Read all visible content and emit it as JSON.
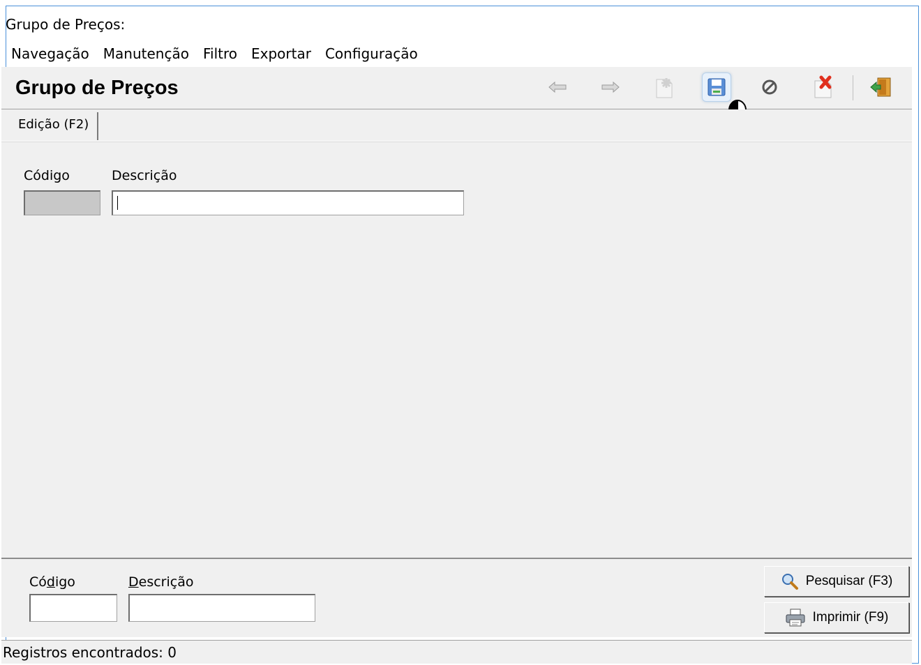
{
  "window": {
    "title": "Grupo de Preços:"
  },
  "menu": {
    "items": [
      "Navegação",
      "Manutenção",
      "Filtro",
      "Exportar",
      "Configuração"
    ]
  },
  "header": {
    "title": "Grupo de Preços"
  },
  "toolbar": {
    "icons": [
      "arrow-left-icon",
      "arrow-right-icon",
      "new-record-icon",
      "save-icon",
      "cancel-icon",
      "delete-icon",
      "exit-icon"
    ]
  },
  "tabs": [
    {
      "label": "Edição (F2)"
    }
  ],
  "edit_form": {
    "codigo_label": "Código",
    "codigo_value": "",
    "descricao_label": "Descrição",
    "descricao_value": ""
  },
  "search": {
    "codigo_label_pre": "Có",
    "codigo_label_ul": "d",
    "codigo_label_post": "igo",
    "codigo_value": "",
    "descricao_label_pre": "",
    "descricao_label_ul": "D",
    "descricao_label_post": "escrição",
    "descricao_value": "",
    "search_button": "Pesquisar (F3)",
    "print_button": "Imprimir (F9)"
  },
  "status": {
    "text": "Registros encontrados: 0"
  }
}
